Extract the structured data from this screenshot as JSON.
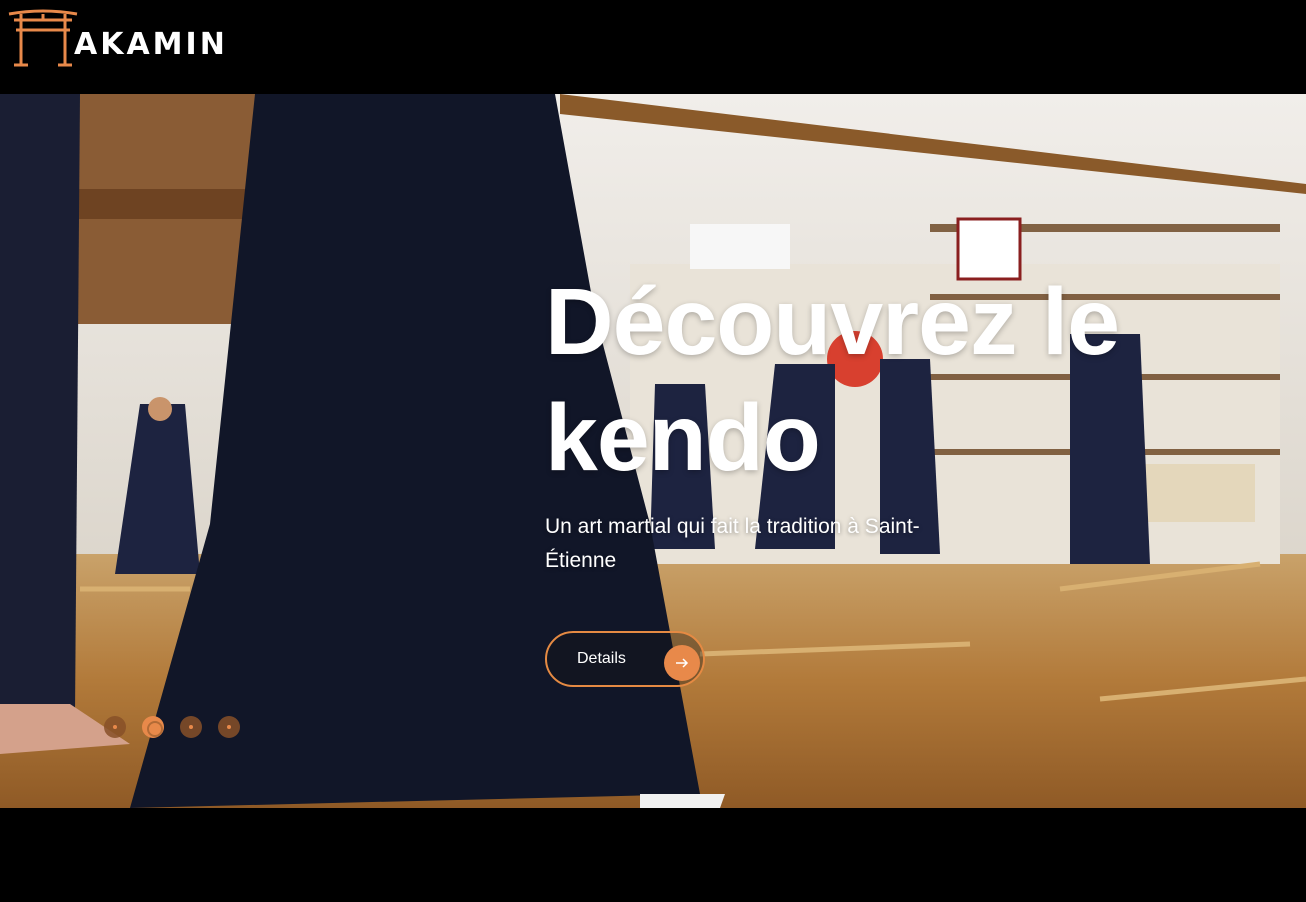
{
  "brand": {
    "logo_text": "AKAMIN",
    "logo_icon": "torii-gate-icon",
    "accent_color": "#e8894a"
  },
  "hero": {
    "title": "Découvrez le kendo",
    "subtitle": "Un art martial qui fait la tradition à Saint-Étienne",
    "cta_label": "Details",
    "cta_icon": "arrow-right-icon",
    "background_scene": "kendo-dojo-photo"
  },
  "carousel": {
    "slide_count": 4,
    "active_index": 1
  }
}
